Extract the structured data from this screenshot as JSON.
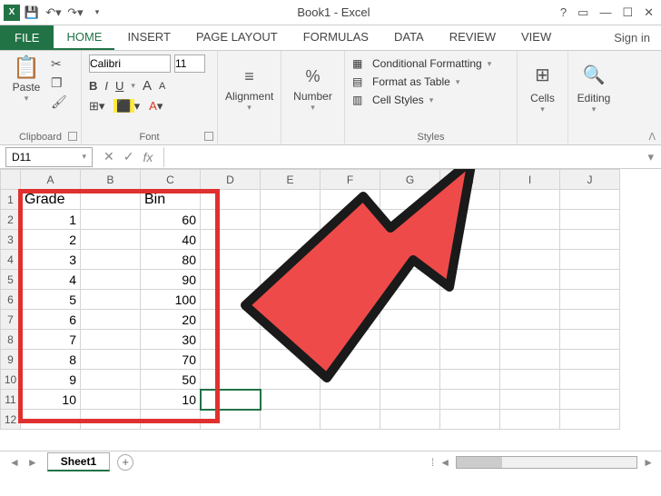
{
  "title": "Book1 - Excel",
  "tabs": {
    "file": "FILE",
    "home": "HOME",
    "insert": "INSERT",
    "pagelayout": "PAGE LAYOUT",
    "formulas": "FORMULAS",
    "data": "DATA",
    "review": "REVIEW",
    "view": "VIEW"
  },
  "signin": "Sign in",
  "ribbon": {
    "clipboard": {
      "paste": "Paste",
      "label": "Clipboard"
    },
    "font": {
      "name": "Calibri",
      "size": "11",
      "bold": "B",
      "italic": "I",
      "underline": "U",
      "grow": "A",
      "shrink": "A",
      "label": "Font"
    },
    "alignment": {
      "label": "Alignment"
    },
    "number": {
      "label": "Number",
      "symbol": "%"
    },
    "styles": {
      "cond": "Conditional Formatting",
      "table": "Format as Table",
      "cell": "Cell Styles",
      "label": "Styles"
    },
    "cells": {
      "label": "Cells"
    },
    "editing": {
      "label": "Editing"
    }
  },
  "namebox": "D11",
  "fx": "fx",
  "columns": [
    "A",
    "B",
    "C",
    "D",
    "E",
    "F",
    "G",
    "H",
    "I",
    "J"
  ],
  "rows": [
    "1",
    "2",
    "3",
    "4",
    "5",
    "6",
    "7",
    "8",
    "9",
    "10",
    "11",
    "12"
  ],
  "data_headers": {
    "a": "Grade",
    "c": "Bin"
  },
  "data_rows": [
    {
      "a": "1",
      "c": "60"
    },
    {
      "a": "2",
      "c": "40"
    },
    {
      "a": "3",
      "c": "80"
    },
    {
      "a": "4",
      "c": "90"
    },
    {
      "a": "5",
      "c": "100"
    },
    {
      "a": "6",
      "c": "20"
    },
    {
      "a": "7",
      "c": "30"
    },
    {
      "a": "8",
      "c": "70"
    },
    {
      "a": "9",
      "c": "50"
    },
    {
      "a": "10",
      "c": "10"
    }
  ],
  "sheet": "Sheet1",
  "selected_cell": "D11",
  "colors": {
    "excel_green": "#217346",
    "highlight_red": "#e03030",
    "arrow_fill": "#ef4a4a"
  }
}
